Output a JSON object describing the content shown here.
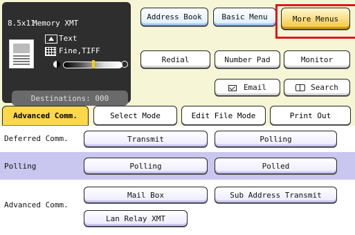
{
  "status": {
    "paper_size": "8.5x11",
    "mode": "Memory XMT",
    "original_type": "Text",
    "resolution": "Fine,TIFF",
    "destinations_label": "Destinations: 000"
  },
  "top_buttons": {
    "address_book": "Address Book",
    "basic_menu": "Basic Menu",
    "more_menus": "More Menus",
    "redial": "Redial",
    "number_pad": "Number Pad",
    "monitor": "Monitor",
    "email": "Email",
    "search": "Search"
  },
  "tabs": [
    {
      "label": "Advanced Comm.",
      "active": true
    },
    {
      "label": "Select Mode",
      "active": false
    },
    {
      "label": "Edit File Mode",
      "active": false
    },
    {
      "label": "Print Out",
      "active": false
    }
  ],
  "rows": {
    "deferred": {
      "label": "Deferred Comm.",
      "buttons": [
        "Transmit",
        "Polling"
      ]
    },
    "polling": {
      "label": "Polling",
      "buttons": [
        "Polling",
        "Polled"
      ]
    },
    "advanced": {
      "label": "Advanced Comm.",
      "buttons": [
        "Mail Box",
        "Sub Address Transmit",
        "Lan Relay XMT"
      ]
    }
  },
  "colors": {
    "background": "#f6f6d6",
    "active_tab": "#fdd84a",
    "polling_row": "#c9c7ef",
    "highlight_box": "#e0141c",
    "more_menus": "#f3c43a"
  }
}
